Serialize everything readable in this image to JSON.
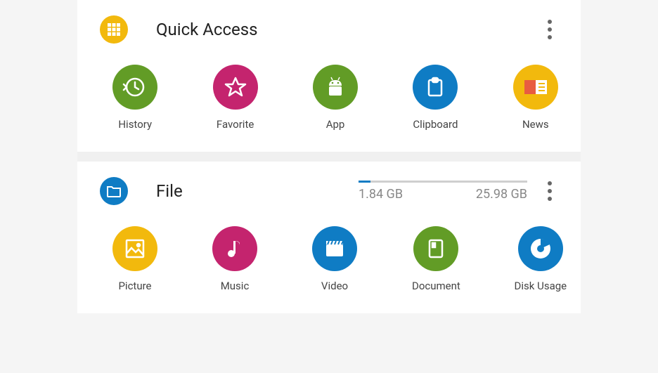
{
  "colors": {
    "yellow": "#f2b90d",
    "green": "#629c26",
    "magenta": "#c4246e",
    "blue": "#0f7cc4",
    "grey": "#666666"
  },
  "quick": {
    "title": "Quick Access",
    "items": [
      {
        "key": "history",
        "label": "History",
        "color": "green",
        "icon": "history"
      },
      {
        "key": "favorite",
        "label": "Favorite",
        "color": "magenta",
        "icon": "star"
      },
      {
        "key": "app",
        "label": "App",
        "color": "green",
        "icon": "android"
      },
      {
        "key": "clipboard",
        "label": "Clipboard",
        "color": "blue",
        "icon": "clipboard"
      },
      {
        "key": "news",
        "label": "News",
        "color": "yellow",
        "icon": "news"
      }
    ]
  },
  "file": {
    "title": "File",
    "storage": {
      "used": "1.84 GB",
      "total": "25.98 GB",
      "percent": 7
    },
    "items": [
      {
        "key": "picture",
        "label": "Picture",
        "color": "yellow",
        "icon": "picture"
      },
      {
        "key": "music",
        "label": "Music",
        "color": "magenta",
        "icon": "music"
      },
      {
        "key": "video",
        "label": "Video",
        "color": "blue",
        "icon": "video"
      },
      {
        "key": "document",
        "label": "Document",
        "color": "green",
        "icon": "document"
      },
      {
        "key": "diskusage",
        "label": "Disk Usage",
        "color": "blue",
        "icon": "disk"
      }
    ]
  }
}
